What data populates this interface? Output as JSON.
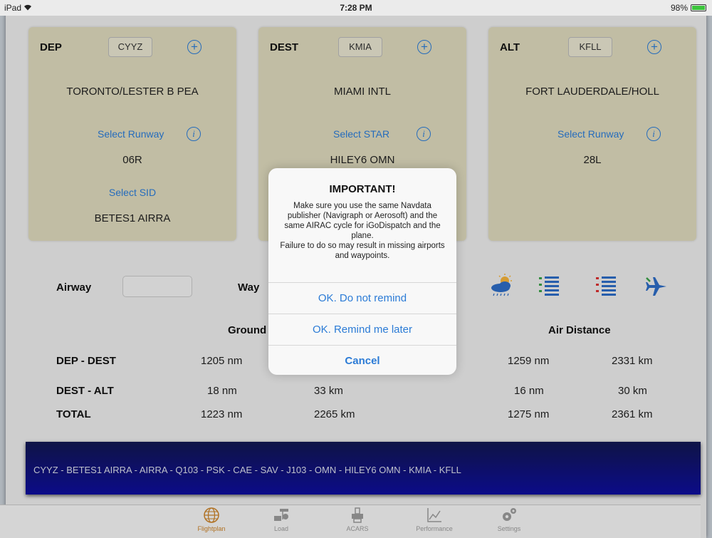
{
  "status": {
    "device": "iPad",
    "wifi_icon": "wifi-icon",
    "time": "7:28 PM",
    "battery": "98%"
  },
  "dep": {
    "tag": "DEP",
    "code": "CYYZ",
    "name": "TORONTO/LESTER B PEA",
    "runway_link": "Select Runway",
    "runway": "06R",
    "proc_link": "Select SID",
    "proc": "BETES1 AIRRA"
  },
  "dest": {
    "tag": "DEST",
    "code": "KMIA",
    "name": "MIAMI INTL",
    "proc_link": "Select STAR",
    "proc": "HILEY6 OMN"
  },
  "alt": {
    "tag": "ALT",
    "code": "KFLL",
    "name": "FORT LAUDERDALE/HOLL",
    "runway_link": "Select Runway",
    "runway": "28L"
  },
  "airway": {
    "label": "Airway",
    "input_value": "",
    "waypoint_label": "Way"
  },
  "distances": {
    "ground_header": "Ground",
    "air_header": "Air Distance",
    "rows": [
      {
        "label": "DEP - DEST",
        "ground_nm": "1205 nm",
        "ground_km": "",
        "air_nm": "1259 nm",
        "air_km": "2331 km"
      },
      {
        "label": "DEST - ALT",
        "ground_nm": "18 nm",
        "ground_km": "33 km",
        "air_nm": "16 nm",
        "air_km": "30 km"
      },
      {
        "label": "TOTAL",
        "ground_nm": "1223 nm",
        "ground_km": "2265 km",
        "air_nm": "1275 nm",
        "air_km": "2361 km"
      }
    ]
  },
  "route": "CYYZ - BETES1 AIRRA - AIRRA - Q103 - PSK - CAE - SAV - J103 - OMN - HILEY6 OMN - KMIA - KFLL",
  "tabs": [
    {
      "label": "Flightplan",
      "icon": "globe-icon"
    },
    {
      "label": "Load",
      "icon": "cargo-loader-icon"
    },
    {
      "label": "ACARS",
      "icon": "printer-icon"
    },
    {
      "label": "Performance",
      "icon": "performance-chart-icon"
    },
    {
      "label": "Settings",
      "icon": "gears-icon"
    }
  ],
  "dialog": {
    "title": "IMPORTANT!",
    "message": "Make sure you use the same Navdata publisher (Navigraph or Aerosoft) and the same AIRAC cycle for iGoDispatch and the plane.\nFailure to do so may result in missing airports and waypoints.",
    "buttons": {
      "no_remind": "OK. Do not remind",
      "later": "OK. Remind me later",
      "cancel": "Cancel"
    }
  },
  "colors": {
    "accent": "#2b7bd6",
    "card": "#dcd8bb",
    "route_bg": "#0d0d9c",
    "active_tab": "#c9822a"
  }
}
